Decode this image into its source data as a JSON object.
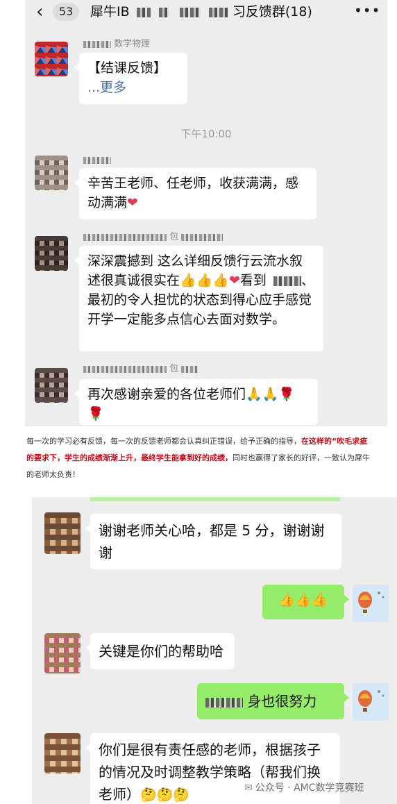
{
  "top_chat": {
    "navbar": {
      "back_icon": "chevron-left-icon",
      "unread_count": "53",
      "title_prefix": "犀牛IB",
      "title_suffix": "习反馈群(18)",
      "more_icon": "ellipsis-icon"
    },
    "messages": [
      {
        "sender": "数学物理",
        "lines": [
          "【结课反馈】"
        ],
        "more": "...更多"
      },
      {
        "time": "下午10:00"
      },
      {
        "sender": "",
        "text": "辛苦王老师、任老师，收获满满，感动满满"
      },
      {
        "sender": "包",
        "text_a": "深深震撼到 这么详细反馈行云流水叙述很真诚很实在",
        "text_b": "看到",
        "text_c": "、最初的令人担忧的状态到得心应手感觉开学一定能多点信心去面对数学。"
      },
      {
        "sender": "包",
        "text": "再次感谢亲爱的各位老师们"
      }
    ]
  },
  "caption": {
    "part1": "每一次的学习必有反馈，每一次的反馈老师都会认真纠正错误，给予正确的指导，",
    "part2_red": "在这样的“吹毛求疵",
    "part3_red": "的要求下，学生的成绩渐渐上升，最终学生能拿到好的成绩，",
    "part4": "同时也赢得了家长的好评，一致认为犀牛",
    "part5": "的老师太负责！"
  },
  "bottom_chat": {
    "messages": [
      {
        "side": "left",
        "text": "谢谢老师关心哈，都是 5 分，谢谢谢谢"
      },
      {
        "side": "right",
        "emoji": "thumbs-up x3"
      },
      {
        "side": "left",
        "text": "关键是你们的帮助哈"
      },
      {
        "side": "right",
        "text": "身也很努力"
      },
      {
        "side": "left",
        "text": "你们是很有责任感的老师，根据孩子的情况及时调整教学策略（帮我们换老师）"
      }
    ]
  },
  "watermark": "公众号 · AMC数学竞赛班"
}
